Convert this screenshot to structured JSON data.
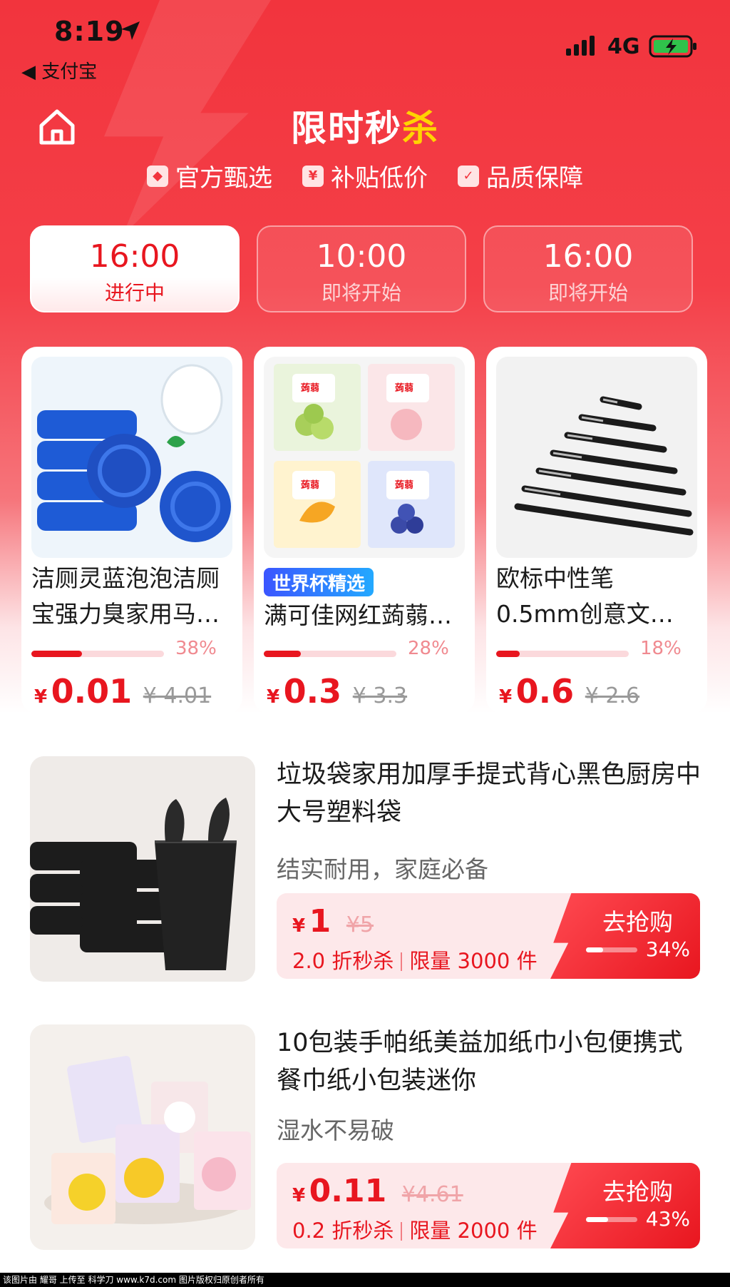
{
  "status_bar": {
    "time": "8:19",
    "back_label": "◀ 支付宝",
    "network": "4G"
  },
  "header": {
    "title_part1": "限时秒",
    "title_part2": "杀",
    "tags": [
      "官方甄选",
      "补贴低价",
      "品质保障"
    ]
  },
  "time_slots": [
    {
      "time": "16:00",
      "status": "进行中",
      "active": true
    },
    {
      "time": "10:00",
      "status": "即将开始",
      "active": false
    },
    {
      "time": "16:00",
      "status": "即将开始",
      "active": false
    }
  ],
  "cards": [
    {
      "title_line1": "洁厕灵蓝泡泡洁厕",
      "title_line2": "宝强力臭家用马…",
      "progress": 0.38,
      "progress_text": "38%",
      "price_symbol": "¥",
      "price": "0.01",
      "original_price": "¥ 4.01",
      "badge": ""
    },
    {
      "title_line1": "",
      "title_line2": "满可佳网红蒟蒻…",
      "progress": 0.28,
      "progress_text": "28%",
      "price_symbol": "¥",
      "price": "0.3",
      "original_price": "¥ 3.3",
      "badge": "世界杯精选"
    },
    {
      "title_line1": "欧标中性笔",
      "title_line2": "0.5mm创意文…",
      "progress": 0.18,
      "progress_text": "18%",
      "price_symbol": "¥",
      "price": "0.6",
      "original_price": "¥ 2.6",
      "badge": ""
    }
  ],
  "list_items": [
    {
      "title": "垃圾袋家用加厚手提式背心黑色厨房中大号塑料袋",
      "subtitle": "结实耐用，家庭必备",
      "price_symbol": "¥",
      "price": "1",
      "original_price": "¥5",
      "discount": "2.0 折秒杀",
      "limit": "限量 3000 件",
      "button_label": "去抢购",
      "progress": 0.34,
      "progress_text": "34%"
    },
    {
      "title": "10包装手帕纸美益加纸巾小包便携式餐巾纸小包装迷你",
      "subtitle": "湿水不易破",
      "price_symbol": "¥",
      "price": "0.11",
      "original_price": "¥4.61",
      "discount": "0.2 折秒杀",
      "limit": "限量 2000 件",
      "button_label": "去抢购",
      "progress": 0.43,
      "progress_text": "43%"
    }
  ],
  "footer": "该图片由 耀哥 上传至 科学刀 www.k7d.com 图片版权归原创者所有",
  "colors": {
    "primary": "#e8161f",
    "hero": "#f2343d",
    "accent_yellow": "#ffd400"
  }
}
